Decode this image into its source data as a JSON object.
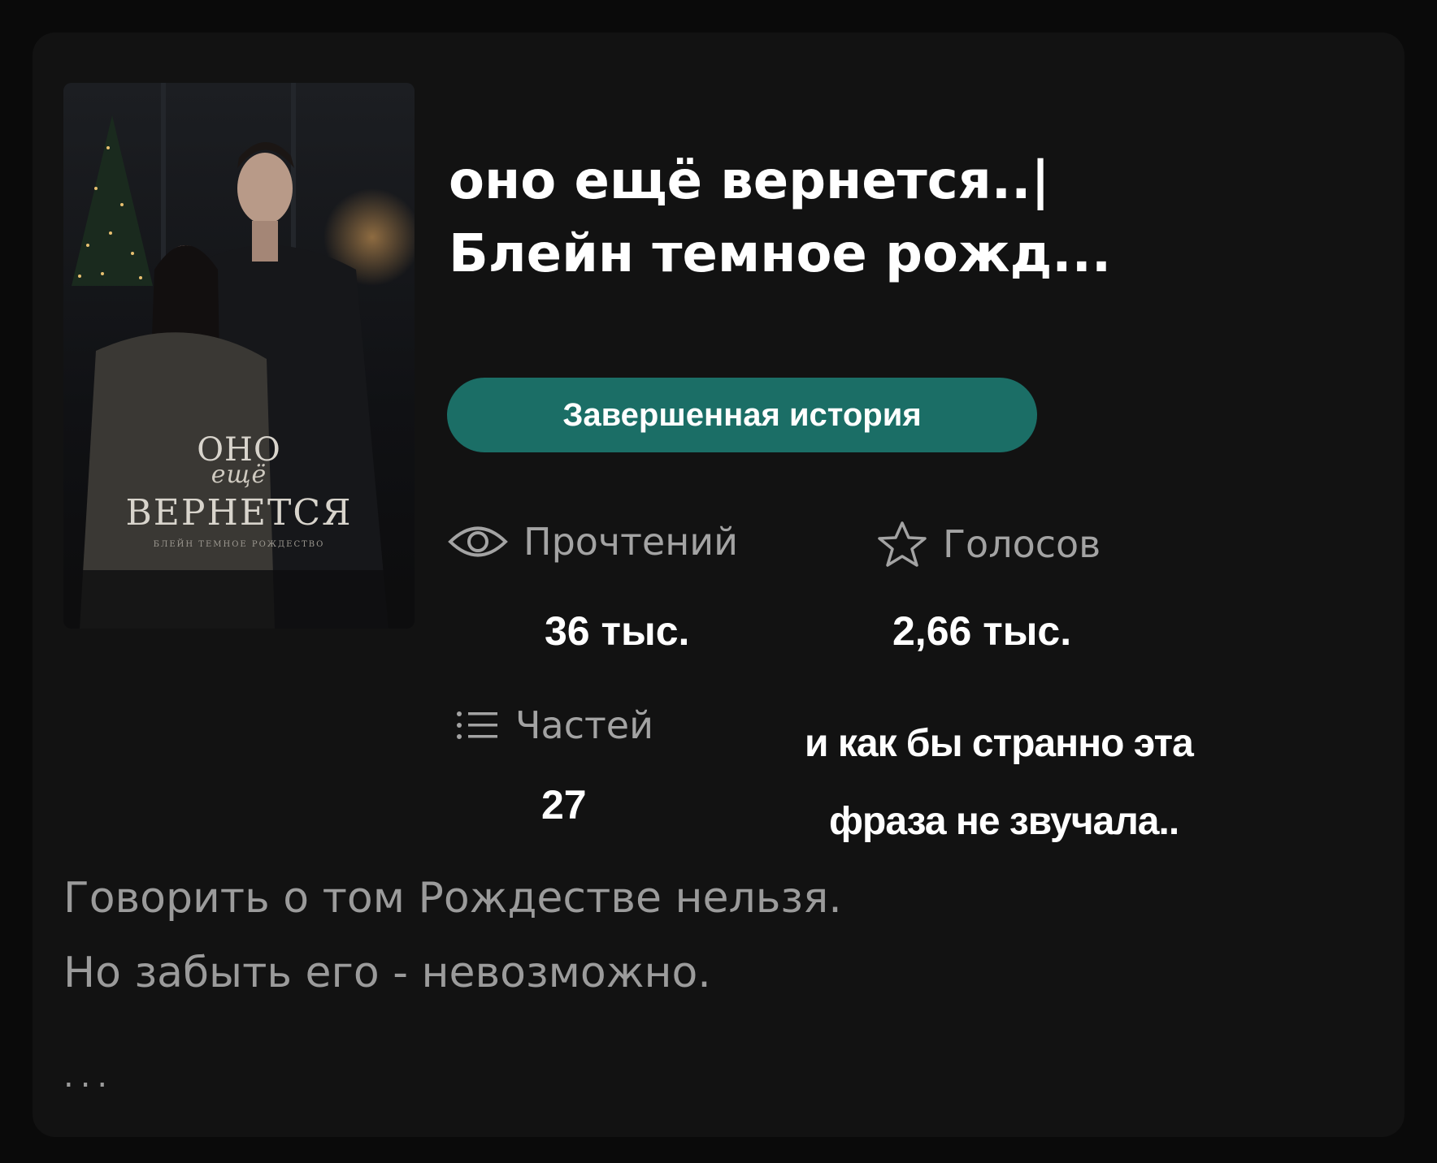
{
  "story": {
    "title_line1": "оно ещё вернется..|",
    "title_line2": "Блейн темное рожд...",
    "status_badge": "Завершенная история"
  },
  "cover": {
    "line1": "ОНО",
    "line2": "ещё",
    "line3": "ВЕРНЕТСЯ",
    "line4": "БЛЕЙН ТЕМНОЕ РОЖДЕСТВО"
  },
  "stats": {
    "reads_label": "Прочтений",
    "reads_value": "36 тыс.",
    "votes_label": "Голосов",
    "votes_value": "2,66 тыс.",
    "parts_label": "Частей",
    "parts_value": "27"
  },
  "overlay": {
    "line1": "и как бы странно эта",
    "line2": "фраза не звучала.."
  },
  "description": {
    "line1": "Говорить о том Рождестве нельзя.",
    "line2": "Но забыть его - невозможно.",
    "more": "..."
  },
  "icons": {
    "reads": "eye-icon",
    "votes": "star-outline-icon",
    "parts": "list-icon"
  },
  "colors": {
    "background": "#121212",
    "badge": "#1b6e66",
    "muted_text": "#a3a3a3"
  }
}
